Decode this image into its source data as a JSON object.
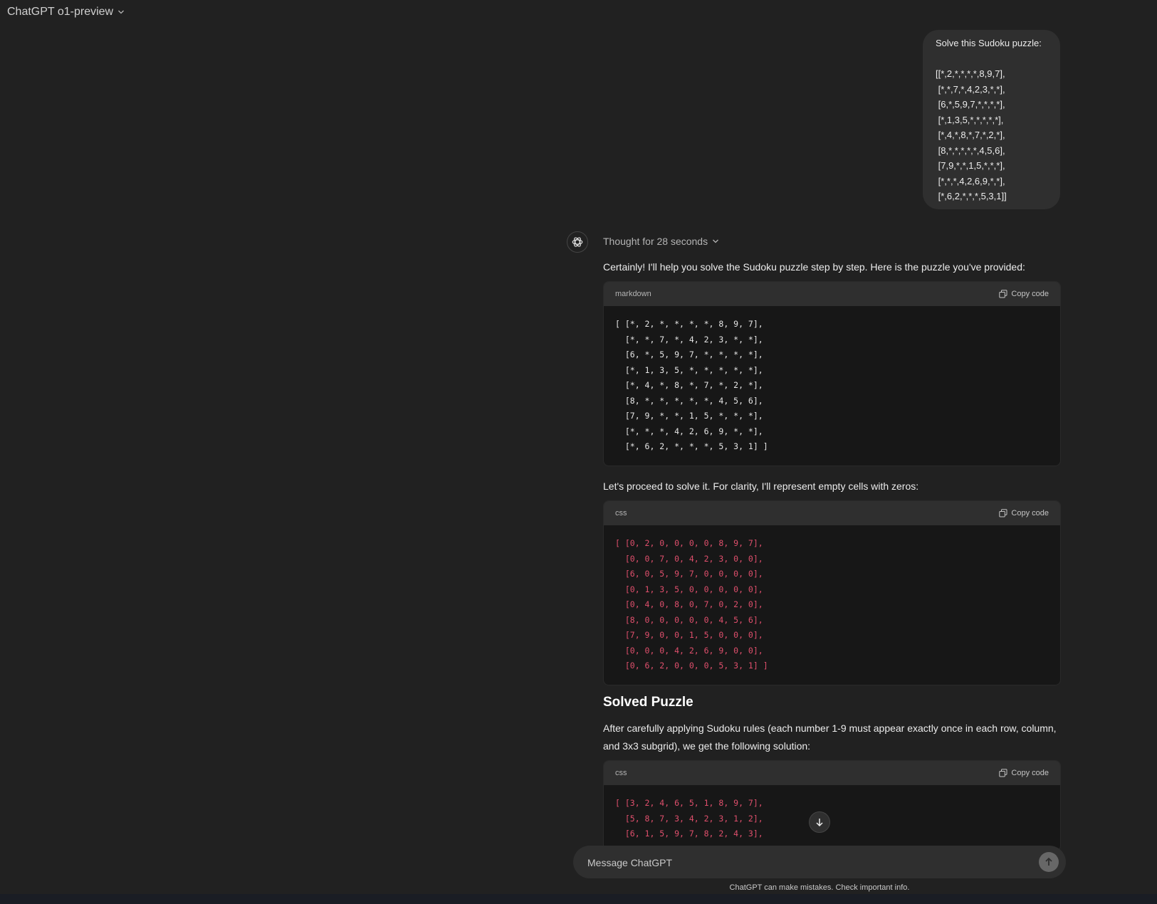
{
  "header": {
    "title": "ChatGPT o1-preview"
  },
  "user_message": {
    "intro": "Solve this Sudoku puzzle:",
    "rows": [
      "[[*,2,*,*,*,*,8,9,7],",
      " [*,*,7,*,4,2,3,*,*],",
      " [6,*,5,9,7,*,*,*,*],",
      " [*,1,3,5,*,*,*,*,*],",
      " [*,4,*,8,*,7,*,2,*],",
      " [8,*,*,*,*,*,4,5,6],",
      " [7,9,*,*,1,5,*,*,*],",
      " [*,*,*,4,2,6,9,*,*],",
      " [*,6,2,*,*,*,5,3,1]]"
    ]
  },
  "assistant": {
    "thought": "Thought for 28 seconds",
    "intro": "Certainly! I'll help you solve the Sudoku puzzle step by step. Here is the puzzle you've provided:",
    "proceed": "Let's proceed to solve it. For clarity, I'll represent empty cells with zeros:",
    "solved_heading": "Solved Puzzle",
    "solved_text": "After carefully applying Sudoku rules (each number 1-9 must appear exactly once in each row, column, and 3x3 subgrid), we get the following solution:"
  },
  "code_blocks": [
    {
      "lang": "markdown",
      "copy_label": "Copy code",
      "lines": [
        "[ [*, 2, *, *, *, *, 8, 9, 7],",
        "  [*, *, 7, *, 4, 2, 3, *, *],",
        "  [6, *, 5, 9, 7, *, *, *, *],",
        "  [*, 1, 3, 5, *, *, *, *, *],",
        "  [*, 4, *, 8, *, 7, *, 2, *],",
        "  [8, *, *, *, *, *, 4, 5, 6],",
        "  [7, 9, *, *, 1, 5, *, *, *],",
        "  [*, *, *, 4, 2, 6, 9, *, *],",
        "  [*, 6, 2, *, *, *, 5, 3, 1] ]"
      ]
    },
    {
      "lang": "css",
      "copy_label": "Copy code",
      "lines": [
        "[ [0, 2, 0, 0, 0, 0, 8, 9, 7],",
        "  [0, 0, 7, 0, 4, 2, 3, 0, 0],",
        "  [6, 0, 5, 9, 7, 0, 0, 0, 0],",
        "  [0, 1, 3, 5, 0, 0, 0, 0, 0],",
        "  [0, 4, 0, 8, 0, 7, 0, 2, 0],",
        "  [8, 0, 0, 0, 0, 0, 4, 5, 6],",
        "  [7, 9, 0, 0, 1, 5, 0, 0, 0],",
        "  [0, 0, 0, 4, 2, 6, 9, 0, 0],",
        "  [0, 6, 2, 0, 0, 0, 5, 3, 1] ]"
      ]
    },
    {
      "lang": "css",
      "copy_label": "Copy code",
      "lines": [
        "[ [3, 2, 4, 6, 5, 1, 8, 9, 7],",
        "  [5, 8, 7, 3, 4, 2, 3, 1, 2],",
        "  [6, 1, 5, 9, 7, 8, 2, 4, 3],"
      ]
    }
  ],
  "composer": {
    "placeholder": "Message ChatGPT"
  },
  "disclaimer": "ChatGPT can make mistakes. Check important info.",
  "icons": {
    "header": "chevron-down-icon",
    "avatar": "openai-logo-icon",
    "thought": "chevron-down-icon",
    "copy": "copy-icon",
    "scroll": "arrow-down-icon",
    "send": "arrow-up-icon"
  },
  "colors": {
    "background": "#212121",
    "bubble": "#2f2f2f",
    "code_bg": "#171717",
    "code_red": "#df4f6c"
  }
}
